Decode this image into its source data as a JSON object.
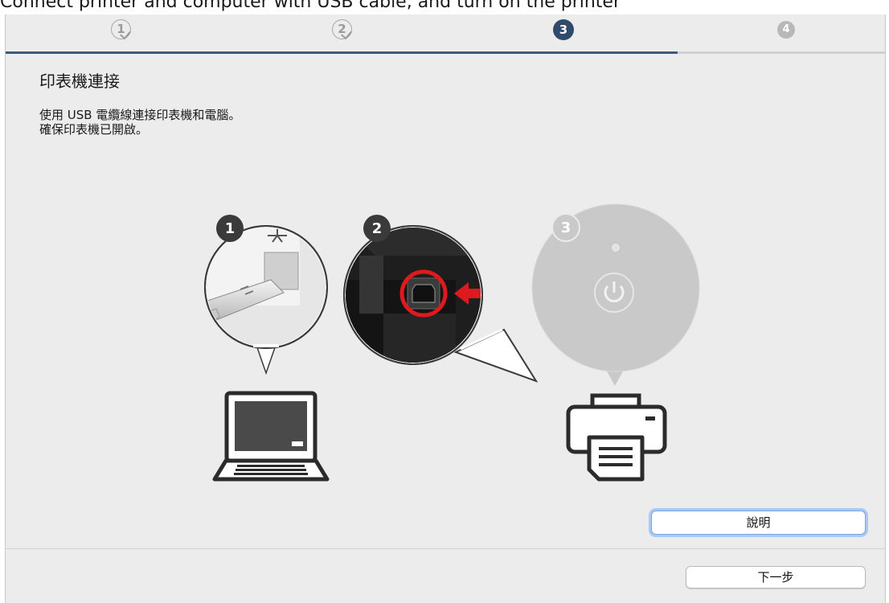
{
  "caption": "Connect printer and computer with USB cable, and turn on the printer",
  "steps": [
    "1",
    "2",
    "3",
    "4"
  ],
  "progress_fraction": 0.764,
  "page_title": "印表機連接",
  "instructions": {
    "line1": "使用 USB 電纜線連接印表機和電腦。",
    "line2": "確保印表機已開啟。"
  },
  "illustration": {
    "badges": [
      "1",
      "2",
      "3"
    ],
    "icons": [
      "usb-plug-icon",
      "usb-port-icon",
      "power-icon",
      "laptop-icon",
      "printer-icon",
      "arrow-icon"
    ]
  },
  "buttons": {
    "help": "說明",
    "next": "下一步"
  },
  "colors": {
    "current_step": "#2f4a6b",
    "highlight_ring": "#e0191f",
    "focus_ring": "#a9c9f2"
  }
}
